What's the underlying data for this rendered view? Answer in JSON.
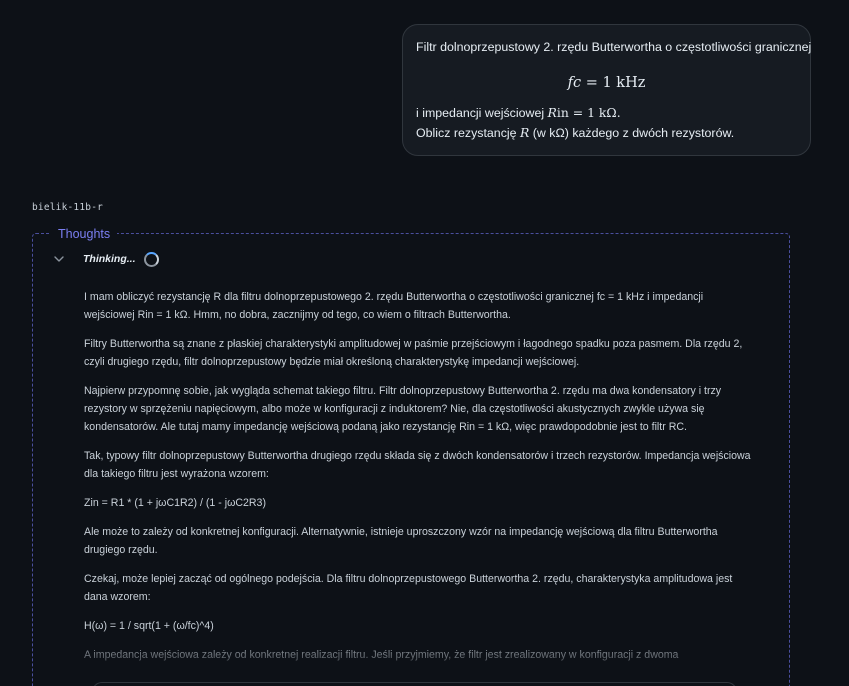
{
  "user_message": {
    "line1": "Filtr dolnoprzepustowy 2. rzędu Butterwortha o częstotliwości granicznej",
    "math_fc_var": "fc",
    "math_fc_value": "= 1 kHz",
    "line2_prefix": "i impedancji wejściowej ",
    "math_rin_var": "R",
    "math_rin_sub": "in",
    "math_rin_value": " = 1 kΩ.",
    "line3_prefix": "Oblicz rezystancję ",
    "math_r_var": "R",
    "line3_suffix": " (w kΩ) każdego z dwóch rezystorów."
  },
  "model_label": "bielik-11b-r",
  "thoughts": {
    "legend": "Thoughts",
    "status": "Thinking...",
    "paragraphs": [
      "I mam obliczyć rezystancję R dla filtru dolnoprzepustowego 2. rzędu Butterwortha o częstotliwości granicznej fc = 1 kHz i impedancji wejściowej Rin = 1 kΩ. Hmm, no dobra, zacznijmy od tego, co wiem o filtrach Butterwortha.",
      "Filtry Butterwortha są znane z płaskiej charakterystyki amplitudowej w paśmie przejściowym i łagodnego spadku poza pasmem. Dla rzędu 2, czyli drugiego rzędu, filtr dolnoprzepustowy będzie miał określoną charakterystykę impedancji wejściowej.",
      "Najpierw przypomnę sobie, jak wygląda schemat takiego filtru. Filtr dolnoprzepustowy Butterwortha 2. rzędu ma dwa kondensatory i trzy rezystory w sprzężeniu napięciowym, albo może w konfiguracji z induktorem? Nie, dla częstotliwości akustycznych zwykle używa się kondensatorów. Ale tutaj mamy impedancję wejściową podaną jako rezystancję Rin = 1 kΩ, więc prawdopodobnie jest to filtr RC.",
      "Tak, typowy filtr dolnoprzepustowy Butterwortha drugiego rzędu składa się z dwóch kondensatorów i trzech rezystorów. Impedancja wejściowa dla takiego filtru jest wyrażona wzorem:",
      "Zin = R1 * (1 + jωC1R2) / (1 - jωC2R3)",
      "Ale może to zależy od konkretnej konfiguracji. Alternatywnie, istnieje uproszczony wzór na impedancję wejściową dla filtru Butterwortha drugiego rzędu.",
      "Czekaj, może lepiej zacząć od ogólnego podejścia. Dla filtru dolnoprzepustowego Butterwortha 2. rzędu, charakterystyka amplitudowa jest dana wzorem:",
      "H(ω) = 1 / sqrt(1 + (ω/fc)^4)",
      "A impedancja wejściowa zależy od konkretnej realizacji filtru. Jeśli przyjmiemy, że filtr jest zrealizowany w konfiguracji z dwoma"
    ]
  },
  "colors": {
    "background": "#0d1117",
    "bubble": "#161b22",
    "accent": "#7b7ff2",
    "dashed_border": "#4a4f9e"
  }
}
